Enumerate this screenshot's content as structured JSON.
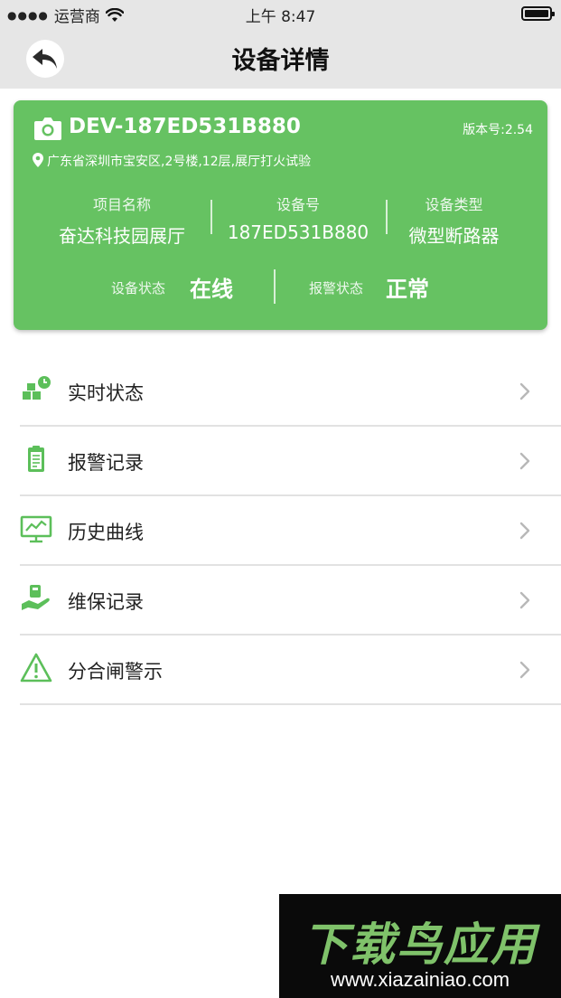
{
  "status_bar": {
    "carrier": "运营商",
    "time": "上午 8:47"
  },
  "nav": {
    "title": "设备详情"
  },
  "device": {
    "id": "DEV-187ED531B880",
    "version_label": "版本号:",
    "version": "2.54",
    "address": "广东省深圳市宝安区,2号楼,12层,展厅打火试验",
    "info": [
      {
        "label": "项目名称",
        "value": "奋达科技园展厅"
      },
      {
        "label": "设备号",
        "value": "187ED531B880"
      },
      {
        "label": "设备类型",
        "value": "微型断路器"
      }
    ],
    "device_status_label": "设备状态",
    "device_status": "在线",
    "alarm_status_label": "报警状态",
    "alarm_status": "正常"
  },
  "menu": [
    {
      "label": "实时状态",
      "icon": "realtime-status-icon"
    },
    {
      "label": "报警记录",
      "icon": "alarm-record-icon"
    },
    {
      "label": "历史曲线",
      "icon": "history-curve-icon"
    },
    {
      "label": "维保记录",
      "icon": "maintenance-record-icon"
    },
    {
      "label": "分合闸警示",
      "icon": "warning-triangle-icon"
    }
  ],
  "watermark": {
    "title": "下载鸟应用",
    "url": "www.xiazainiao.com"
  },
  "colors": {
    "card_green": "#66c262",
    "icon_green": "#5cbf5a",
    "nav_bg": "#e6e6e6"
  }
}
